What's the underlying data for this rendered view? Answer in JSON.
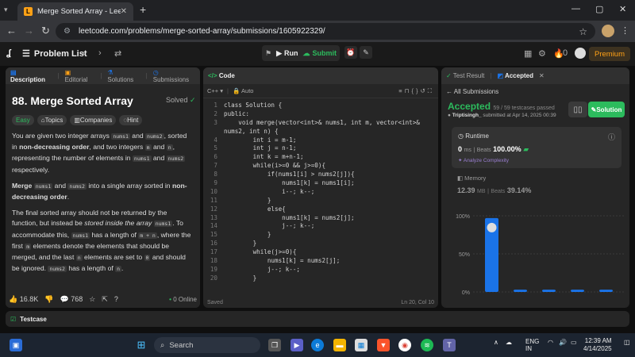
{
  "browser": {
    "tab_title": "Merge Sorted Array - LeetCode",
    "url": "leetcode.com/problems/merge-sorted-array/submissions/1605922329/"
  },
  "header": {
    "problem_list": "Problem List",
    "run": "Run",
    "submit": "Submit",
    "streak": "0",
    "premium": "Premium"
  },
  "description": {
    "tabs": [
      "Description",
      "Editorial",
      "Solutions",
      "Submissions"
    ],
    "title": "88. Merge Sorted Array",
    "solved": "Solved",
    "tags": [
      "Easy",
      "Topics",
      "Companies",
      "Hint"
    ],
    "p1_a": "You are given two integer arrays ",
    "p1_b": " and ",
    "p1_c": ", sorted in ",
    "p1_bold": "non-decreasing order",
    "p1_d": ", and two integers ",
    "p1_e": " and ",
    "p1_f": ", representing the number of elements in ",
    "p1_g": " and ",
    "p1_h": " respectively.",
    "p2_bold1": "Merge",
    "p2_a": " and ",
    "p2_b": " into a single array sorted in ",
    "p2_bold2": "non-decreasing order",
    "p2_c": ".",
    "p3_a": "The final sorted array should not be returned by the function, but instead be ",
    "p3_em": "stored inside the array",
    "p3_b": ". To accommodate this, ",
    "p3_c": " has a length of ",
    "p3_d": ", where the first ",
    "p3_e": " elements denote the elements that should be merged, and the last ",
    "p3_f": " elements are set to ",
    "p3_g": " and should be ignored. ",
    "p3_h": " has a length of ",
    "p3_i": ".",
    "c_nums1": "nums1",
    "c_nums2": "nums2",
    "c_m": "m",
    "c_n": "n",
    "c_mn": "m + n",
    "c_zero": "0",
    "likes": "16.8K",
    "comments": "768",
    "online": "0 Online"
  },
  "code": {
    "tab": "Code",
    "language": "C++",
    "mode": "Auto",
    "status": "Saved",
    "cursor": "Ln 20, Col 10",
    "lines": [
      "class Solution {",
      "public:",
      "    void merge(vector<int>& nums1, int m, vector<int>&",
      "nums2, int n) {",
      "        int i = m-1;",
      "        int j = n-1;",
      "        int k = m+n-1;",
      "        while(i>=0 && j>=0){",
      "            if(nums1[i] > nums2[j]){",
      "                nums1[k] = nums1[i];",
      "                i--; k--;",
      "            }",
      "            else{",
      "                nums1[k] = nums2[j];",
      "                j--; k--;",
      "            }",
      "        }",
      "        while(j>=0){",
      "            nums1[k] = nums2[j];",
      "            j--; k--;",
      "        }"
    ],
    "line_numbers": [
      "1",
      "2",
      "3",
      "",
      "4",
      "5",
      "6",
      "7",
      "8",
      "9",
      "10",
      "11",
      "12",
      "13",
      "14",
      "15",
      "16",
      "17",
      "18",
      "19",
      "20"
    ]
  },
  "result": {
    "tabs": [
      "Test Result",
      "Accepted"
    ],
    "all_submissions": "All Submissions",
    "status": "Accepted",
    "testcases": "59 / 59 testcases passed",
    "user": "Triptisingh_",
    "submitted": "submitted at Apr 14, 2025 00:39",
    "solution_btn": "Solution",
    "runtime_label": "Runtime",
    "runtime_val": "0",
    "runtime_unit": "ms",
    "beats_label": "Beats",
    "runtime_beats": "100.00%",
    "analyze": "Analyze Complexity",
    "memory_label": "Memory",
    "memory_val": "12.39",
    "memory_unit": "MB",
    "memory_beats": "39.14%",
    "chart_ticks": [
      "100%",
      "50%",
      "0%"
    ]
  },
  "chart_data": {
    "type": "bar",
    "categories": [
      "",
      "",
      "",
      "",
      ""
    ],
    "values": [
      97,
      3,
      3,
      3,
      3
    ],
    "ylim": [
      0,
      100
    ],
    "ytick_labels": [
      "100%",
      "50%",
      "0%"
    ],
    "color": "#1a73e8"
  },
  "testcase": {
    "label": "Testcase"
  },
  "taskbar": {
    "search": "Search",
    "lang": "ENG",
    "region": "IN",
    "time": "12:39 AM",
    "date": "4/14/2025"
  }
}
